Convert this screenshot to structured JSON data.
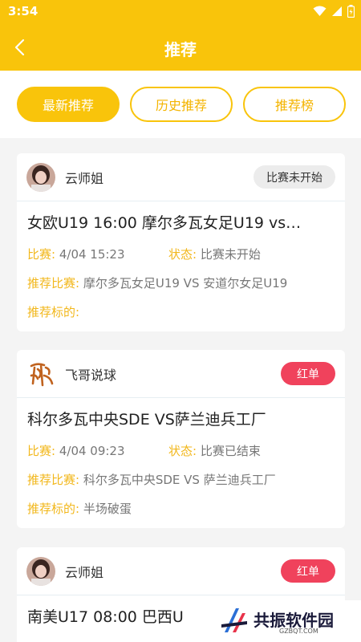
{
  "status_bar": {
    "time": "3:54"
  },
  "header": {
    "title": "推荐"
  },
  "tabs": [
    {
      "label": "最新推荐",
      "active": true
    },
    {
      "label": "历史推荐",
      "active": false
    },
    {
      "label": "推荐榜",
      "active": false
    }
  ],
  "labels": {
    "match": "比赛:",
    "status": "状态:",
    "rec_match": "推荐比赛:",
    "rec_target": "推荐标的:"
  },
  "cards": [
    {
      "author": "云师姐",
      "badge": "比赛未开始",
      "title": "女欧U19 16:00 摩尔多瓦女足U19 vs…",
      "match_time": "4/04 15:23",
      "status": "比赛未开始",
      "rec_match": "摩尔多瓦女足U19 VS 安道尔女足U19",
      "rec_target": ""
    },
    {
      "author": "飞哥说球",
      "badge": "红单",
      "title": "科尔多瓦中央SDE VS萨兰迪兵工厂",
      "match_time": "4/04 09:23",
      "status": "比赛已结束",
      "rec_match": "科尔多瓦中央SDE VS 萨兰迪兵工厂",
      "rec_target": "半场破蛋"
    },
    {
      "author": "云师姐",
      "badge": "红单",
      "title": "南美U17 08:00 巴西U"
    }
  ],
  "watermark": {
    "text": "共振软件园",
    "url": "GZBQT.COM"
  },
  "colors": {
    "brand": "#f9c40b",
    "label": "#f2b71b",
    "red_badge": "#f0425c"
  }
}
